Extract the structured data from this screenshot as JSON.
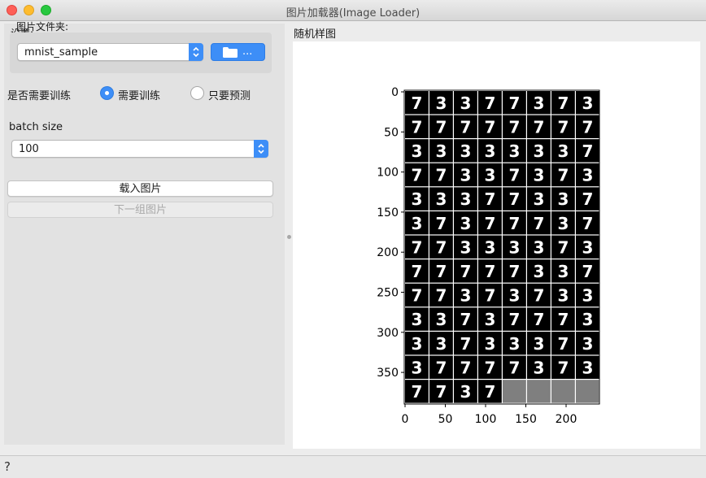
{
  "window": {
    "title": "图片加载器(Image Loader)"
  },
  "settings": {
    "group_label": "设置:",
    "folder_label": "图片文件夹:",
    "folder_value": "mnist_sample",
    "browse_label": "...",
    "train_question": "是否需要训练",
    "train_options": [
      "需要训练",
      "只要预测"
    ],
    "train_selected": "需要训练",
    "batch_label": "batch size",
    "batch_value": "100",
    "load_button": "载入图片",
    "next_button": "下一组图片"
  },
  "preview": {
    "title": "随机样图",
    "y_ticks": [
      "0",
      "50",
      "100",
      "150",
      "200",
      "250",
      "300",
      "350"
    ],
    "x_ticks": [
      "0",
      "50",
      "100",
      "150",
      "200"
    ],
    "grid_rows": 13,
    "grid_cols": 8,
    "image_count": 100,
    "digit_rows": [
      [
        "7",
        "3",
        "3",
        "7",
        "7",
        "3",
        "7",
        "3"
      ],
      [
        "7",
        "7",
        "7",
        "7",
        "7",
        "7",
        "7",
        "7"
      ],
      [
        "3",
        "3",
        "3",
        "3",
        "3",
        "3",
        "3",
        "7"
      ],
      [
        "7",
        "7",
        "3",
        "3",
        "7",
        "3",
        "7",
        "3"
      ],
      [
        "3",
        "3",
        "3",
        "7",
        "7",
        "3",
        "3",
        "7"
      ],
      [
        "3",
        "7",
        "3",
        "7",
        "7",
        "7",
        "3",
        "7"
      ],
      [
        "7",
        "7",
        "3",
        "3",
        "3",
        "3",
        "7",
        "3"
      ],
      [
        "7",
        "7",
        "7",
        "7",
        "7",
        "3",
        "3",
        "7"
      ],
      [
        "7",
        "7",
        "3",
        "7",
        "3",
        "7",
        "3",
        "3"
      ],
      [
        "3",
        "3",
        "7",
        "3",
        "7",
        "7",
        "7",
        "3"
      ],
      [
        "3",
        "3",
        "7",
        "3",
        "3",
        "3",
        "7",
        "3"
      ],
      [
        "3",
        "7",
        "7",
        "7",
        "7",
        "3",
        "7",
        "3"
      ],
      [
        "7",
        "7",
        "3",
        "7"
      ]
    ]
  },
  "statusbar": {
    "help": "?"
  }
}
